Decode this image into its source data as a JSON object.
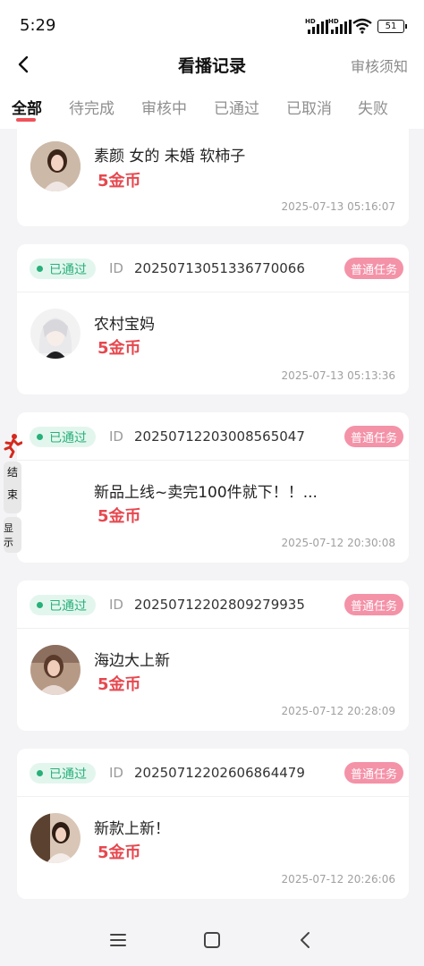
{
  "status_bar": {
    "time": "5:29",
    "battery": "51"
  },
  "header": {
    "title": "看播记录",
    "notice": "审核须知"
  },
  "tabs": [
    {
      "label": "全部",
      "active": true
    },
    {
      "label": "待完成",
      "active": false
    },
    {
      "label": "审核中",
      "active": false
    },
    {
      "label": "已通过",
      "active": false
    },
    {
      "label": "已取消",
      "active": false
    },
    {
      "label": "失败",
      "active": false
    }
  ],
  "records": [
    {
      "title": "素颜 女的 未婚 软柿子",
      "reward": "5金币",
      "time": "2025-07-13 05:16:07"
    },
    {
      "status": "已通过",
      "id_label": "ID",
      "id": "20250713051336770066",
      "type": "普通任务",
      "title": "农村宝妈",
      "reward": "5金币",
      "time": "2025-07-13 05:13:36"
    },
    {
      "status": "已通过",
      "id_label": "ID",
      "id": "20250712203008565047",
      "type": "普通任务",
      "title": "新品上线~卖完100件就下！！...",
      "reward": "5金币",
      "time": "2025-07-12 20:30:08"
    },
    {
      "status": "已通过",
      "id_label": "ID",
      "id": "20250712202809279935",
      "type": "普通任务",
      "title": "海边大上新",
      "reward": "5金币",
      "time": "2025-07-12 20:28:09"
    },
    {
      "status": "已通过",
      "id_label": "ID",
      "id": "20250712202606864479",
      "type": "普通任务",
      "title": "新款上新！",
      "reward": "5金币",
      "time": "2025-07-12 20:26:06"
    }
  ],
  "float_widget": {
    "end_label_1": "结",
    "end_label_2": "束",
    "show_label": "显示"
  },
  "colors": {
    "accent": "#f0525a",
    "reward": "#e6484f",
    "pass_green": "#27b07a",
    "tag_pink": "#f492a8"
  }
}
